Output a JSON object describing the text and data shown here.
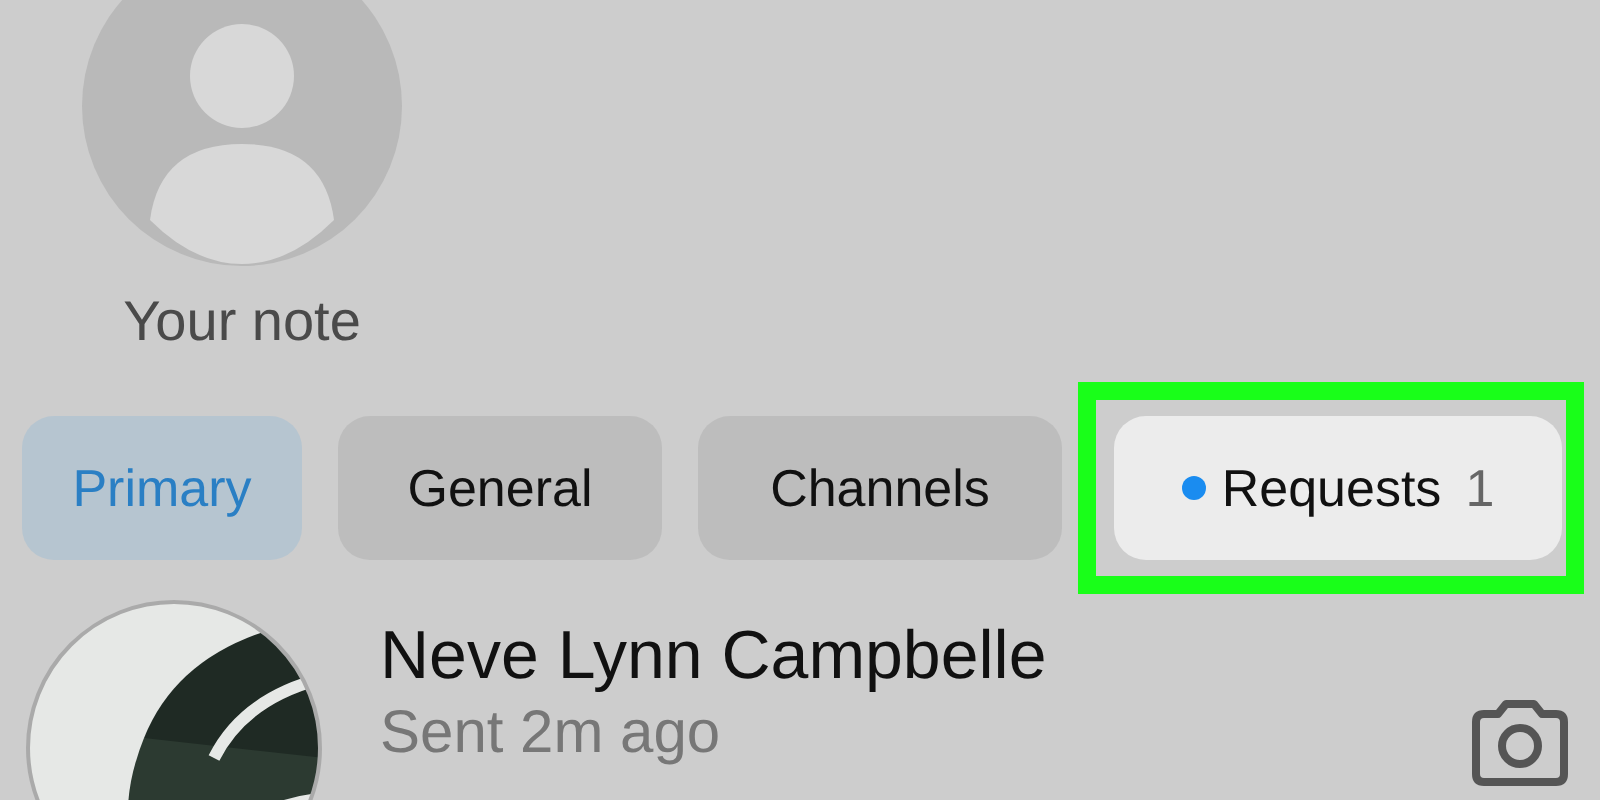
{
  "note": {
    "label": "Your note"
  },
  "tabs": [
    {
      "label": "Primary",
      "selected": true,
      "unread": false,
      "highlighted": false
    },
    {
      "label": "General",
      "selected": false,
      "unread": false,
      "highlighted": false
    },
    {
      "label": "Channels",
      "selected": false,
      "unread": false,
      "highlighted": false
    },
    {
      "label": "Requests",
      "selected": false,
      "unread": true,
      "count": "1",
      "highlighted": true
    }
  ],
  "conversation": {
    "name": "Neve Lynn Campbelle",
    "status": "Sent 2m ago"
  }
}
